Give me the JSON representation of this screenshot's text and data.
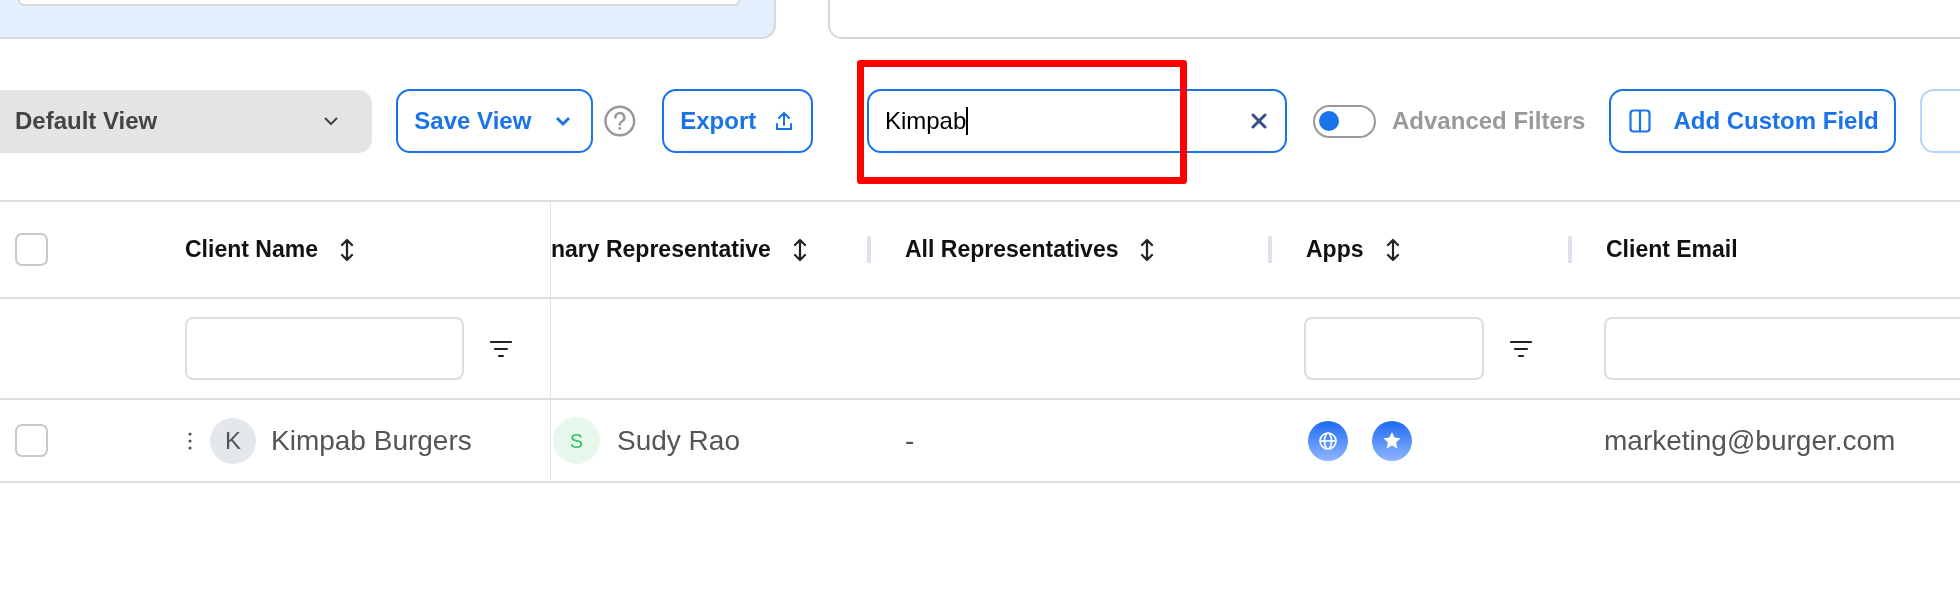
{
  "toolbar": {
    "view_select": {
      "value": "Default View"
    },
    "save_view": {
      "label": "Save View"
    },
    "export": {
      "label": "Export"
    },
    "search": {
      "value": "Kimpab"
    },
    "advanced_filters": {
      "label": "Advanced Filters",
      "on": false
    },
    "add_custom_field": {
      "label": "Add Custom Field"
    }
  },
  "highlight": {
    "kind": "annotation-box"
  },
  "table": {
    "select_all": {
      "checked": false
    },
    "columns": [
      {
        "label": "Client Name",
        "sortable": true,
        "filter_field": true,
        "filter_button": true
      },
      {
        "label": "nary Representative",
        "sortable": true,
        "filter_field": false,
        "filter_button": false
      },
      {
        "label": "All Representatives",
        "sortable": true,
        "filter_field": false,
        "filter_button": false
      },
      {
        "label": "Apps",
        "sortable": true,
        "filter_field": true,
        "filter_button": true
      },
      {
        "label": "Client Email",
        "sortable": false,
        "filter_field": true,
        "filter_button": false
      }
    ],
    "rows": [
      {
        "checked": false,
        "client": {
          "initial": "K",
          "name": "Kimpab Burgers"
        },
        "primary_rep": {
          "initial": "S",
          "name": "Sudy Rao"
        },
        "all_reps": "-",
        "apps": [
          {
            "kind": "globe"
          },
          {
            "kind": "star"
          }
        ],
        "email": "marketing@burger.com"
      }
    ]
  }
}
